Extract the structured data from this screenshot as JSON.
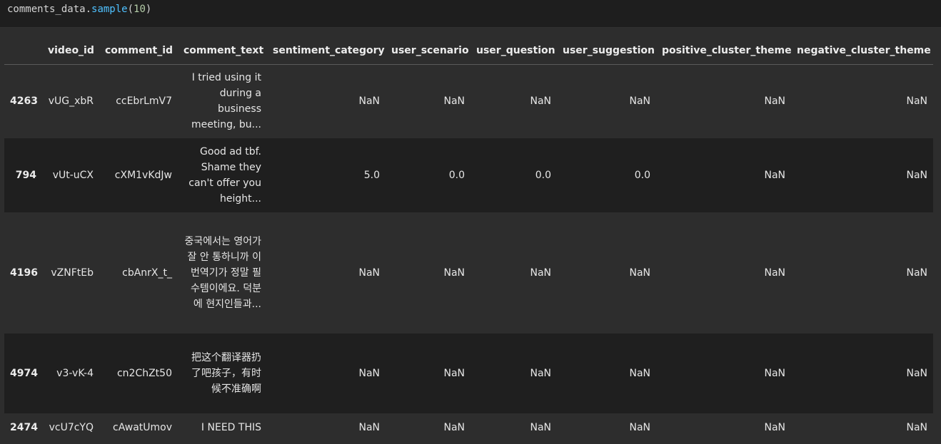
{
  "code": {
    "var": "comments_data",
    "method": "sample",
    "arg": "10"
  },
  "table": {
    "columns": [
      "video_id",
      "comment_id",
      "comment_text",
      "sentiment_category",
      "user_scenario",
      "user_question",
      "user_suggestion",
      "positive_cluster_theme",
      "negative_cluster_theme"
    ],
    "rows": [
      {
        "index": "4263",
        "video_id": "vUG_xbR",
        "comment_id": "ccEbrLmV7",
        "comment_text": "I tried using it during a business meeting, bu...",
        "sentiment_category": "NaN",
        "user_scenario": "NaN",
        "user_question": "NaN",
        "user_suggestion": "NaN",
        "positive_cluster_theme": "NaN",
        "negative_cluster_theme": "NaN"
      },
      {
        "index": "794",
        "video_id": "vUt-uCX",
        "comment_id": "cXM1vKdJw",
        "comment_text": "Good ad tbf. Shame they can't offer you height...",
        "sentiment_category": "5.0",
        "user_scenario": "0.0",
        "user_question": "0.0",
        "user_suggestion": "0.0",
        "positive_cluster_theme": "NaN",
        "negative_cluster_theme": "NaN"
      },
      {
        "index": "4196",
        "video_id": "vZNFtEb",
        "comment_id": "cbAnrX_t_",
        "comment_text": "중국에서는 영어가 잘 안 통하니까 이 번역기가 정말 필수템이에요. 덕분에 현지인들과...",
        "sentiment_category": "NaN",
        "user_scenario": "NaN",
        "user_question": "NaN",
        "user_suggestion": "NaN",
        "positive_cluster_theme": "NaN",
        "negative_cluster_theme": "NaN"
      },
      {
        "index": "4974",
        "video_id": "v3-vK-4",
        "comment_id": "cn2ChZt50",
        "comment_text": "把这个翻译器扔了吧孩子，有时候不准确啊",
        "sentiment_category": "NaN",
        "user_scenario": "NaN",
        "user_question": "NaN",
        "user_suggestion": "NaN",
        "positive_cluster_theme": "NaN",
        "negative_cluster_theme": "NaN"
      },
      {
        "index": "2474",
        "video_id": "vcU7cYQ",
        "comment_id": "cAwatUmov",
        "comment_text": "I NEED THIS",
        "sentiment_category": "NaN",
        "user_scenario": "NaN",
        "user_question": "NaN",
        "user_suggestion": "NaN",
        "positive_cluster_theme": "NaN",
        "negative_cluster_theme": "NaN"
      }
    ]
  }
}
